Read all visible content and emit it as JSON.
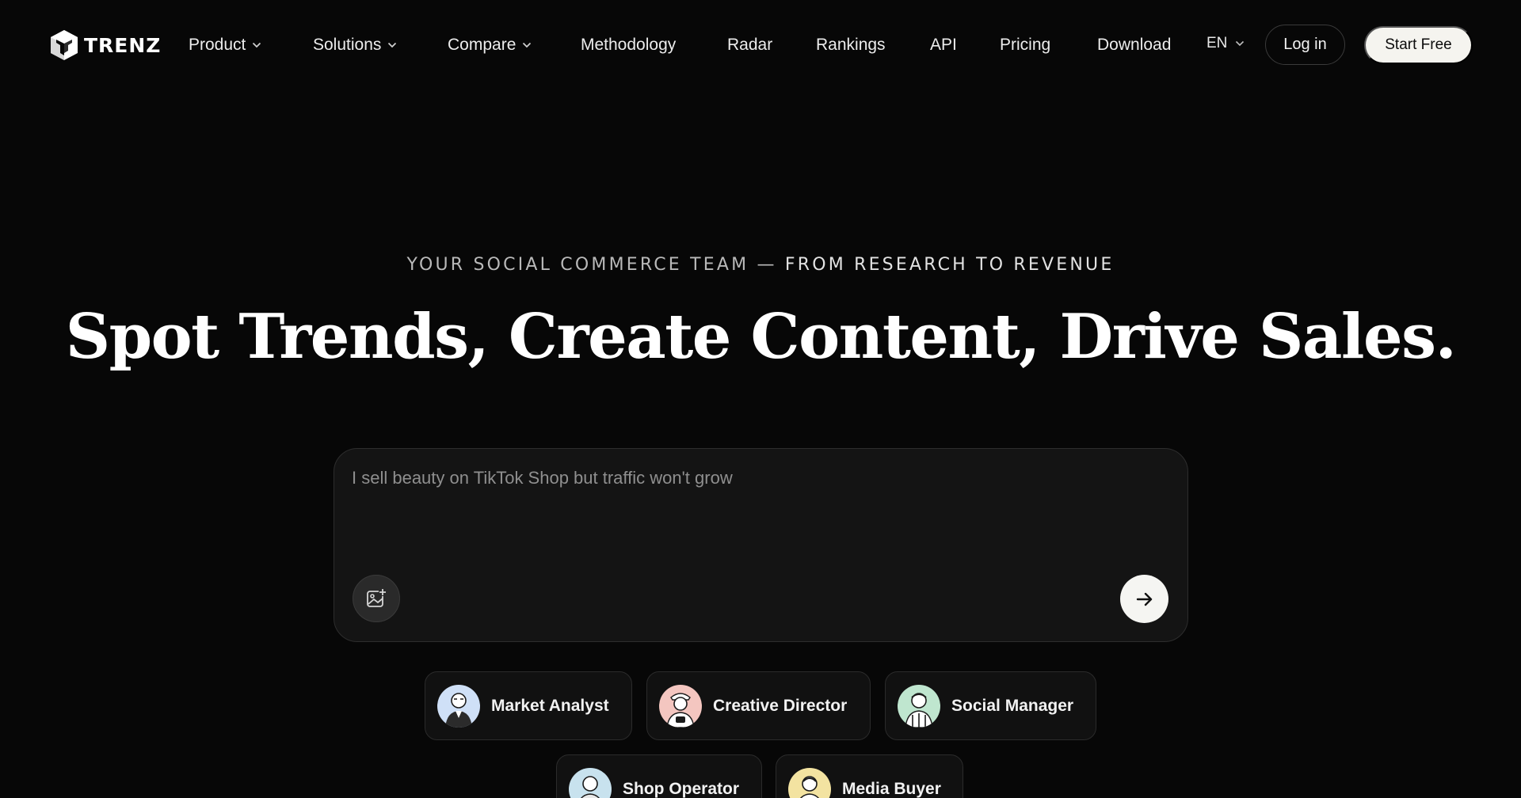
{
  "brand": {
    "name": "TRENZ"
  },
  "nav": {
    "items": [
      {
        "label": "Product",
        "has_dropdown": true
      },
      {
        "label": "Solutions",
        "has_dropdown": true
      },
      {
        "label": "Compare",
        "has_dropdown": true
      },
      {
        "label": "Methodology",
        "has_dropdown": false
      },
      {
        "label": "Radar",
        "has_dropdown": false
      },
      {
        "label": "Rankings",
        "has_dropdown": false
      },
      {
        "label": "API",
        "has_dropdown": false
      },
      {
        "label": "Pricing",
        "has_dropdown": false
      },
      {
        "label": "Download",
        "has_dropdown": false
      }
    ],
    "language": "EN",
    "login_label": "Log in",
    "start_label": "Start Free"
  },
  "hero": {
    "eyebrow_part1": "YOUR SOCIAL COMMERCE TEAM — ",
    "eyebrow_part2": "FROM RESEARCH TO REVENUE",
    "headline": "Spot Trends, Create Content, Drive Sales."
  },
  "prompt": {
    "placeholder": "I sell beauty on TikTok Shop but traffic won't grow",
    "value": "",
    "upload_icon": "image-plus-icon",
    "send_icon": "arrow-right-icon"
  },
  "roles": [
    {
      "label": "Market Analyst",
      "avatar_color": "#cfe0f7"
    },
    {
      "label": "Creative Director",
      "avatar_color": "#f4c6c0"
    },
    {
      "label": "Social Manager",
      "avatar_color": "#bfe6cf"
    },
    {
      "label": "Shop Operator",
      "avatar_color": "#c8e2ee"
    },
    {
      "label": "Media Buyer",
      "avatar_color": "#f3e3a1"
    }
  ],
  "colors": {
    "background": "#070707",
    "primary_button": "#f5f4ef",
    "card": "#141414"
  }
}
